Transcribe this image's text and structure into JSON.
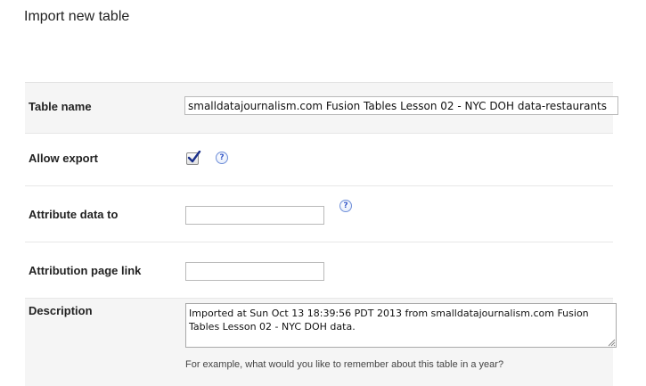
{
  "page": {
    "title": "Import new table"
  },
  "form": {
    "table_name": {
      "label": "Table name",
      "value": "smalldatajournalism.com Fusion Tables Lesson 02 - NYC DOH data-restaurants"
    },
    "allow_export": {
      "label": "Allow export",
      "checked": true,
      "help_icon": "question-help-icon"
    },
    "attribute_data_to": {
      "label": "Attribute data to",
      "value": "",
      "help_icon": "question-help-icon"
    },
    "attribution_page_link": {
      "label": "Attribution page link",
      "value": ""
    },
    "description": {
      "label": "Description",
      "value": "Imported at Sun Oct 13 18:39:56 PDT 2013 from smalldatajournalism.com Fusion Tables Lesson 02 - NYC DOH data.",
      "hint": "For example, what would you like to remember about this table in a year?"
    }
  },
  "colors": {
    "row_highlight": "#f5f5f5",
    "divider": "#e7e7e7",
    "help_icon_blue": "#3558c8"
  }
}
